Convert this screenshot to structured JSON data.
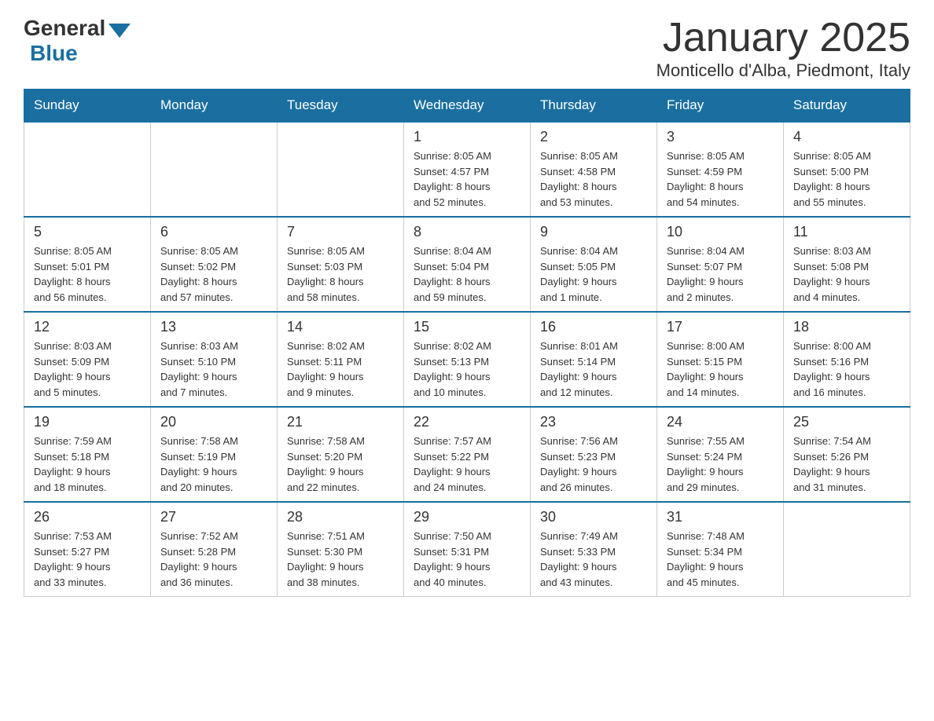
{
  "logo": {
    "general": "General",
    "blue": "Blue"
  },
  "header": {
    "month_year": "January 2025",
    "location": "Monticello d'Alba, Piedmont, Italy"
  },
  "weekdays": [
    "Sunday",
    "Monday",
    "Tuesday",
    "Wednesday",
    "Thursday",
    "Friday",
    "Saturday"
  ],
  "weeks": [
    [
      {
        "day": "",
        "info": ""
      },
      {
        "day": "",
        "info": ""
      },
      {
        "day": "",
        "info": ""
      },
      {
        "day": "1",
        "info": "Sunrise: 8:05 AM\nSunset: 4:57 PM\nDaylight: 8 hours\nand 52 minutes."
      },
      {
        "day": "2",
        "info": "Sunrise: 8:05 AM\nSunset: 4:58 PM\nDaylight: 8 hours\nand 53 minutes."
      },
      {
        "day": "3",
        "info": "Sunrise: 8:05 AM\nSunset: 4:59 PM\nDaylight: 8 hours\nand 54 minutes."
      },
      {
        "day": "4",
        "info": "Sunrise: 8:05 AM\nSunset: 5:00 PM\nDaylight: 8 hours\nand 55 minutes."
      }
    ],
    [
      {
        "day": "5",
        "info": "Sunrise: 8:05 AM\nSunset: 5:01 PM\nDaylight: 8 hours\nand 56 minutes."
      },
      {
        "day": "6",
        "info": "Sunrise: 8:05 AM\nSunset: 5:02 PM\nDaylight: 8 hours\nand 57 minutes."
      },
      {
        "day": "7",
        "info": "Sunrise: 8:05 AM\nSunset: 5:03 PM\nDaylight: 8 hours\nand 58 minutes."
      },
      {
        "day": "8",
        "info": "Sunrise: 8:04 AM\nSunset: 5:04 PM\nDaylight: 8 hours\nand 59 minutes."
      },
      {
        "day": "9",
        "info": "Sunrise: 8:04 AM\nSunset: 5:05 PM\nDaylight: 9 hours\nand 1 minute."
      },
      {
        "day": "10",
        "info": "Sunrise: 8:04 AM\nSunset: 5:07 PM\nDaylight: 9 hours\nand 2 minutes."
      },
      {
        "day": "11",
        "info": "Sunrise: 8:03 AM\nSunset: 5:08 PM\nDaylight: 9 hours\nand 4 minutes."
      }
    ],
    [
      {
        "day": "12",
        "info": "Sunrise: 8:03 AM\nSunset: 5:09 PM\nDaylight: 9 hours\nand 5 minutes."
      },
      {
        "day": "13",
        "info": "Sunrise: 8:03 AM\nSunset: 5:10 PM\nDaylight: 9 hours\nand 7 minutes."
      },
      {
        "day": "14",
        "info": "Sunrise: 8:02 AM\nSunset: 5:11 PM\nDaylight: 9 hours\nand 9 minutes."
      },
      {
        "day": "15",
        "info": "Sunrise: 8:02 AM\nSunset: 5:13 PM\nDaylight: 9 hours\nand 10 minutes."
      },
      {
        "day": "16",
        "info": "Sunrise: 8:01 AM\nSunset: 5:14 PM\nDaylight: 9 hours\nand 12 minutes."
      },
      {
        "day": "17",
        "info": "Sunrise: 8:00 AM\nSunset: 5:15 PM\nDaylight: 9 hours\nand 14 minutes."
      },
      {
        "day": "18",
        "info": "Sunrise: 8:00 AM\nSunset: 5:16 PM\nDaylight: 9 hours\nand 16 minutes."
      }
    ],
    [
      {
        "day": "19",
        "info": "Sunrise: 7:59 AM\nSunset: 5:18 PM\nDaylight: 9 hours\nand 18 minutes."
      },
      {
        "day": "20",
        "info": "Sunrise: 7:58 AM\nSunset: 5:19 PM\nDaylight: 9 hours\nand 20 minutes."
      },
      {
        "day": "21",
        "info": "Sunrise: 7:58 AM\nSunset: 5:20 PM\nDaylight: 9 hours\nand 22 minutes."
      },
      {
        "day": "22",
        "info": "Sunrise: 7:57 AM\nSunset: 5:22 PM\nDaylight: 9 hours\nand 24 minutes."
      },
      {
        "day": "23",
        "info": "Sunrise: 7:56 AM\nSunset: 5:23 PM\nDaylight: 9 hours\nand 26 minutes."
      },
      {
        "day": "24",
        "info": "Sunrise: 7:55 AM\nSunset: 5:24 PM\nDaylight: 9 hours\nand 29 minutes."
      },
      {
        "day": "25",
        "info": "Sunrise: 7:54 AM\nSunset: 5:26 PM\nDaylight: 9 hours\nand 31 minutes."
      }
    ],
    [
      {
        "day": "26",
        "info": "Sunrise: 7:53 AM\nSunset: 5:27 PM\nDaylight: 9 hours\nand 33 minutes."
      },
      {
        "day": "27",
        "info": "Sunrise: 7:52 AM\nSunset: 5:28 PM\nDaylight: 9 hours\nand 36 minutes."
      },
      {
        "day": "28",
        "info": "Sunrise: 7:51 AM\nSunset: 5:30 PM\nDaylight: 9 hours\nand 38 minutes."
      },
      {
        "day": "29",
        "info": "Sunrise: 7:50 AM\nSunset: 5:31 PM\nDaylight: 9 hours\nand 40 minutes."
      },
      {
        "day": "30",
        "info": "Sunrise: 7:49 AM\nSunset: 5:33 PM\nDaylight: 9 hours\nand 43 minutes."
      },
      {
        "day": "31",
        "info": "Sunrise: 7:48 AM\nSunset: 5:34 PM\nDaylight: 9 hours\nand 45 minutes."
      },
      {
        "day": "",
        "info": ""
      }
    ]
  ]
}
